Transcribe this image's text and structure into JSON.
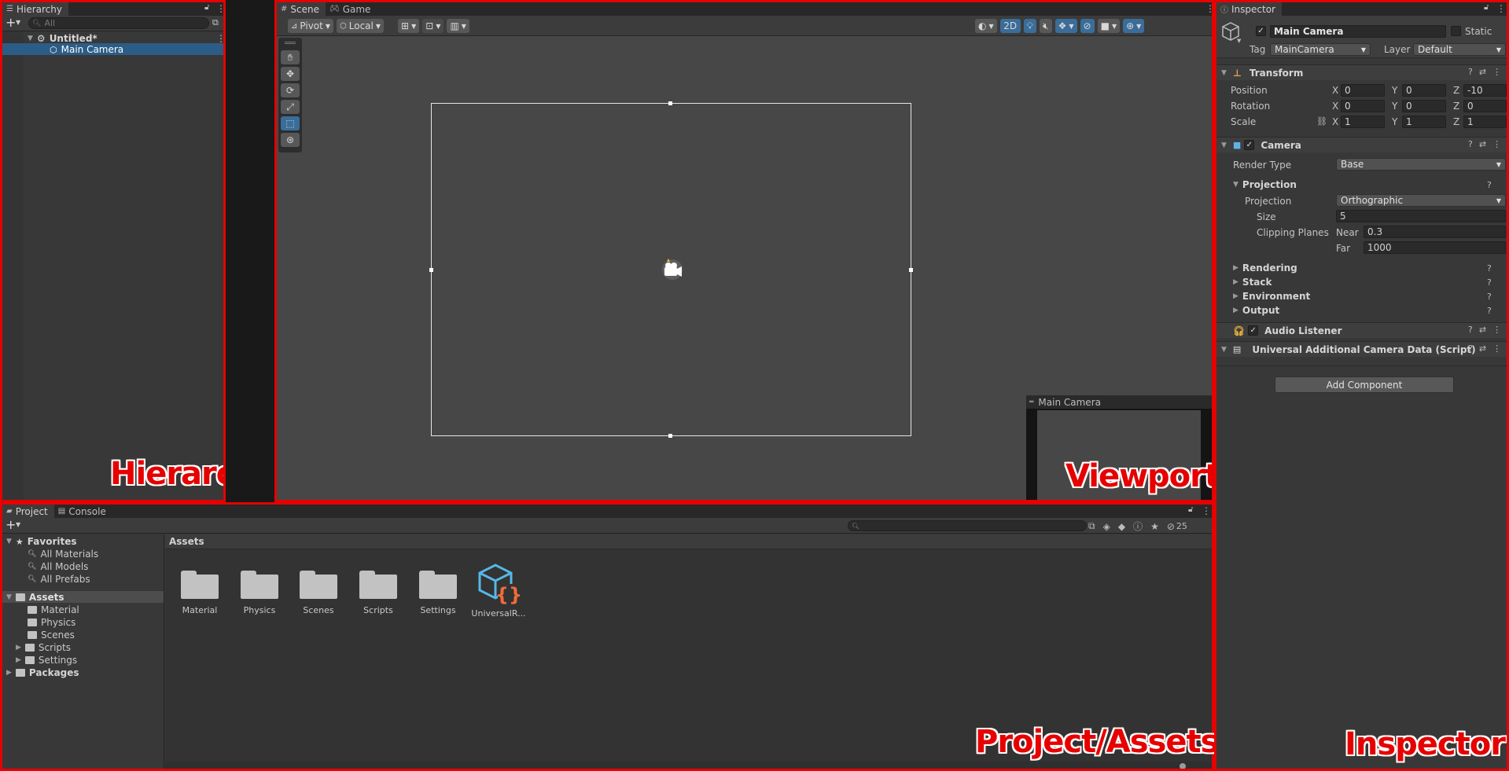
{
  "hierarchy": {
    "tab": "Hierarchy",
    "search_placeholder": "All",
    "scene": "Untitled*",
    "item": "Main Camera",
    "label": "Hierarchy"
  },
  "scene_view": {
    "tabs": [
      "Scene",
      "Game"
    ],
    "pivot": "Pivot",
    "local": "Local",
    "mode_2d": "2D",
    "camera_preview_title": "Main Camera",
    "label": "Viewport"
  },
  "project": {
    "tabs": [
      "Project",
      "Console"
    ],
    "favorites": {
      "title": "Favorites",
      "items": [
        "All Materials",
        "All Models",
        "All Prefabs"
      ]
    },
    "assets_root": "Assets",
    "assets_children": [
      "Material",
      "Physics",
      "Scenes",
      "Scripts",
      "Settings"
    ],
    "packages": "Packages",
    "breadcrumb": "Assets",
    "grid": [
      "Material",
      "Physics",
      "Scenes",
      "Scripts",
      "Settings",
      "UniversalR..."
    ],
    "hidden_count": "25",
    "label": "Project/Assets"
  },
  "inspector": {
    "tab": "Inspector",
    "object_name": "Main Camera",
    "static_label": "Static",
    "tag_label": "Tag",
    "tag_value": "MainCamera",
    "layer_label": "Layer",
    "layer_value": "Default",
    "transform": {
      "title": "Transform",
      "position": {
        "label": "Position",
        "x": "0",
        "y": "0",
        "z": "-10"
      },
      "rotation": {
        "label": "Rotation",
        "x": "0",
        "y": "0",
        "z": "0"
      },
      "scale": {
        "label": "Scale",
        "x": "1",
        "y": "1",
        "z": "1"
      },
      "axis_x": "X",
      "axis_y": "Y",
      "axis_z": "Z"
    },
    "camera": {
      "title": "Camera",
      "render_type_label": "Render Type",
      "render_type": "Base",
      "projection_section": "Projection",
      "projection_label": "Projection",
      "projection_value": "Orthographic",
      "size_label": "Size",
      "size_value": "5",
      "clipping_label": "Clipping Planes",
      "near_label": "Near",
      "near_value": "0.3",
      "far_label": "Far",
      "far_value": "1000",
      "sections": [
        "Rendering",
        "Stack",
        "Environment",
        "Output"
      ]
    },
    "audio_listener": "Audio Listener",
    "script_component": "Universal Additional Camera Data (Script)",
    "add_component": "Add Component",
    "label": "Inspector"
  },
  "colors": {
    "accent_red": "#e60000",
    "selection_blue": "#2c5d87",
    "toggle_blue": "#3a6d99"
  }
}
